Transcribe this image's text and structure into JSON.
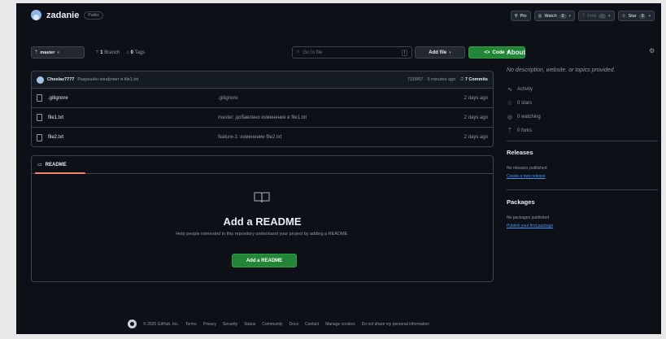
{
  "repo": {
    "name": "zadanie",
    "visibility": "Public"
  },
  "header_actions": {
    "pin": "Pin",
    "watch": "Watch",
    "watch_count": "0",
    "fork": "Fork",
    "fork_count": "0",
    "star": "Star",
    "star_count": "0"
  },
  "toolbar": {
    "branch": "master",
    "branch_count": "1",
    "branch_label": "Branch",
    "tag_count": "0",
    "tag_label": "Tags",
    "search_placeholder": "Go to file",
    "search_key": "t",
    "add_file": "Add file",
    "code": "Code"
  },
  "latest_commit": {
    "user": "Cheslav7777",
    "message": "Разрешён конфликт в file1.txt",
    "hash_time": "7316f07 · 5 minutes ago",
    "commits": "7 Commits"
  },
  "files": [
    {
      "name": ".gitignore",
      "message": ".gitignore",
      "date": "2 days ago"
    },
    {
      "name": "file1.txt",
      "message": "master: добавлено изменение в file1.txt",
      "date": "2 days ago"
    },
    {
      "name": "file2.txt",
      "message": "feature-1: изменение file2.txt",
      "date": "2 days ago"
    }
  ],
  "readme": {
    "tab": "README",
    "title": "Add a README",
    "subtitle": "Help people interested in this repository understand your project by adding a README.",
    "button": "Add a README"
  },
  "about": {
    "heading": "About",
    "description": "No description, website, or topics provided.",
    "activity": "Activity",
    "stars": "0 stars",
    "watching": "0 watching",
    "forks": "0 forks"
  },
  "releases": {
    "heading": "Releases",
    "note": "No releases published",
    "link": "Create a new release"
  },
  "packages": {
    "heading": "Packages",
    "note": "No packages published",
    "link": "Publish your first package"
  },
  "footer": {
    "copyright": "© 2025 GitHub, Inc.",
    "links": [
      "Terms",
      "Privacy",
      "Security",
      "Status",
      "Community",
      "Docs",
      "Contact",
      "Manage cookies",
      "Do not share my personal information"
    ]
  },
  "colors": {
    "background": "#0d1117",
    "accent_green": "#238636",
    "link_blue": "#4493f8",
    "tab_underline": "#f78166"
  }
}
